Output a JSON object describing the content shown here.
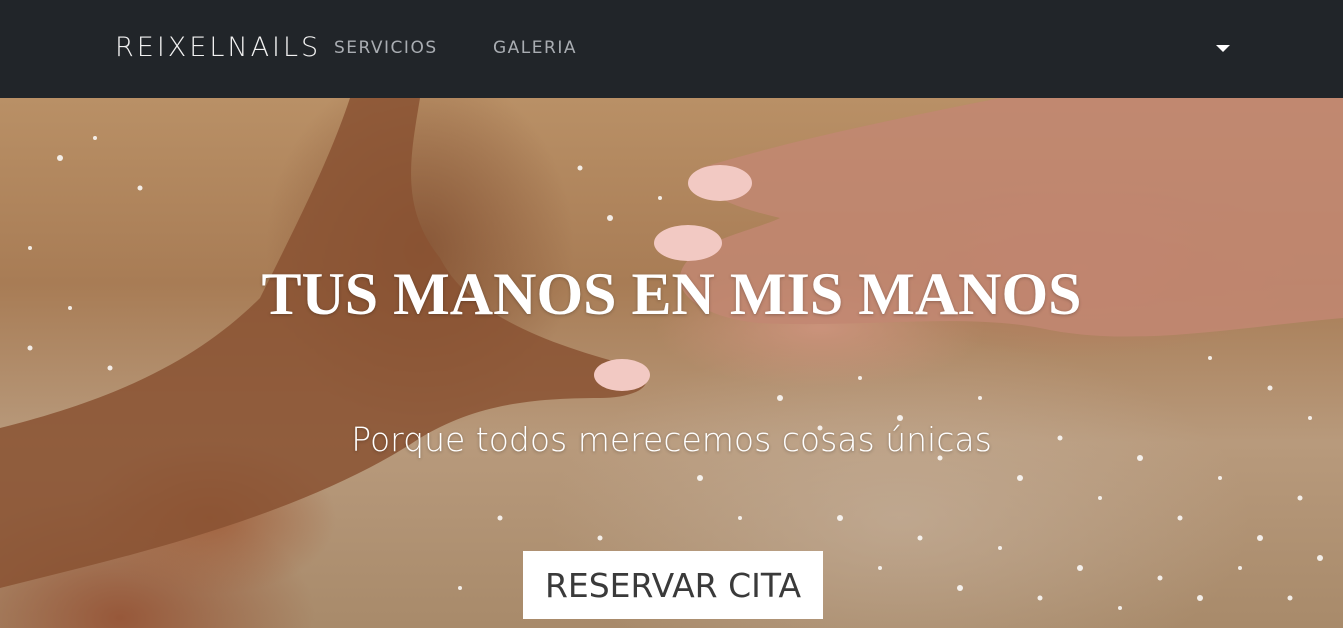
{
  "navbar": {
    "brand": "REIXELNAILS",
    "links": [
      {
        "label": "SERVICIOS"
      },
      {
        "label": "GALERIA"
      }
    ],
    "dropdown_icon": "caret-down-icon"
  },
  "hero": {
    "title": "TUS MANOS EN MIS MANOS",
    "subtitle": "Porque todos merecemos cosas únicas",
    "cta_label": "RESERVAR CITA"
  },
  "colors": {
    "navbar_bg": "#212529",
    "brand_text": "#f1f1f1",
    "nav_link_text": "#a9adb2",
    "cta_bg": "#ffffff",
    "cta_text": "#3a3a3a"
  }
}
